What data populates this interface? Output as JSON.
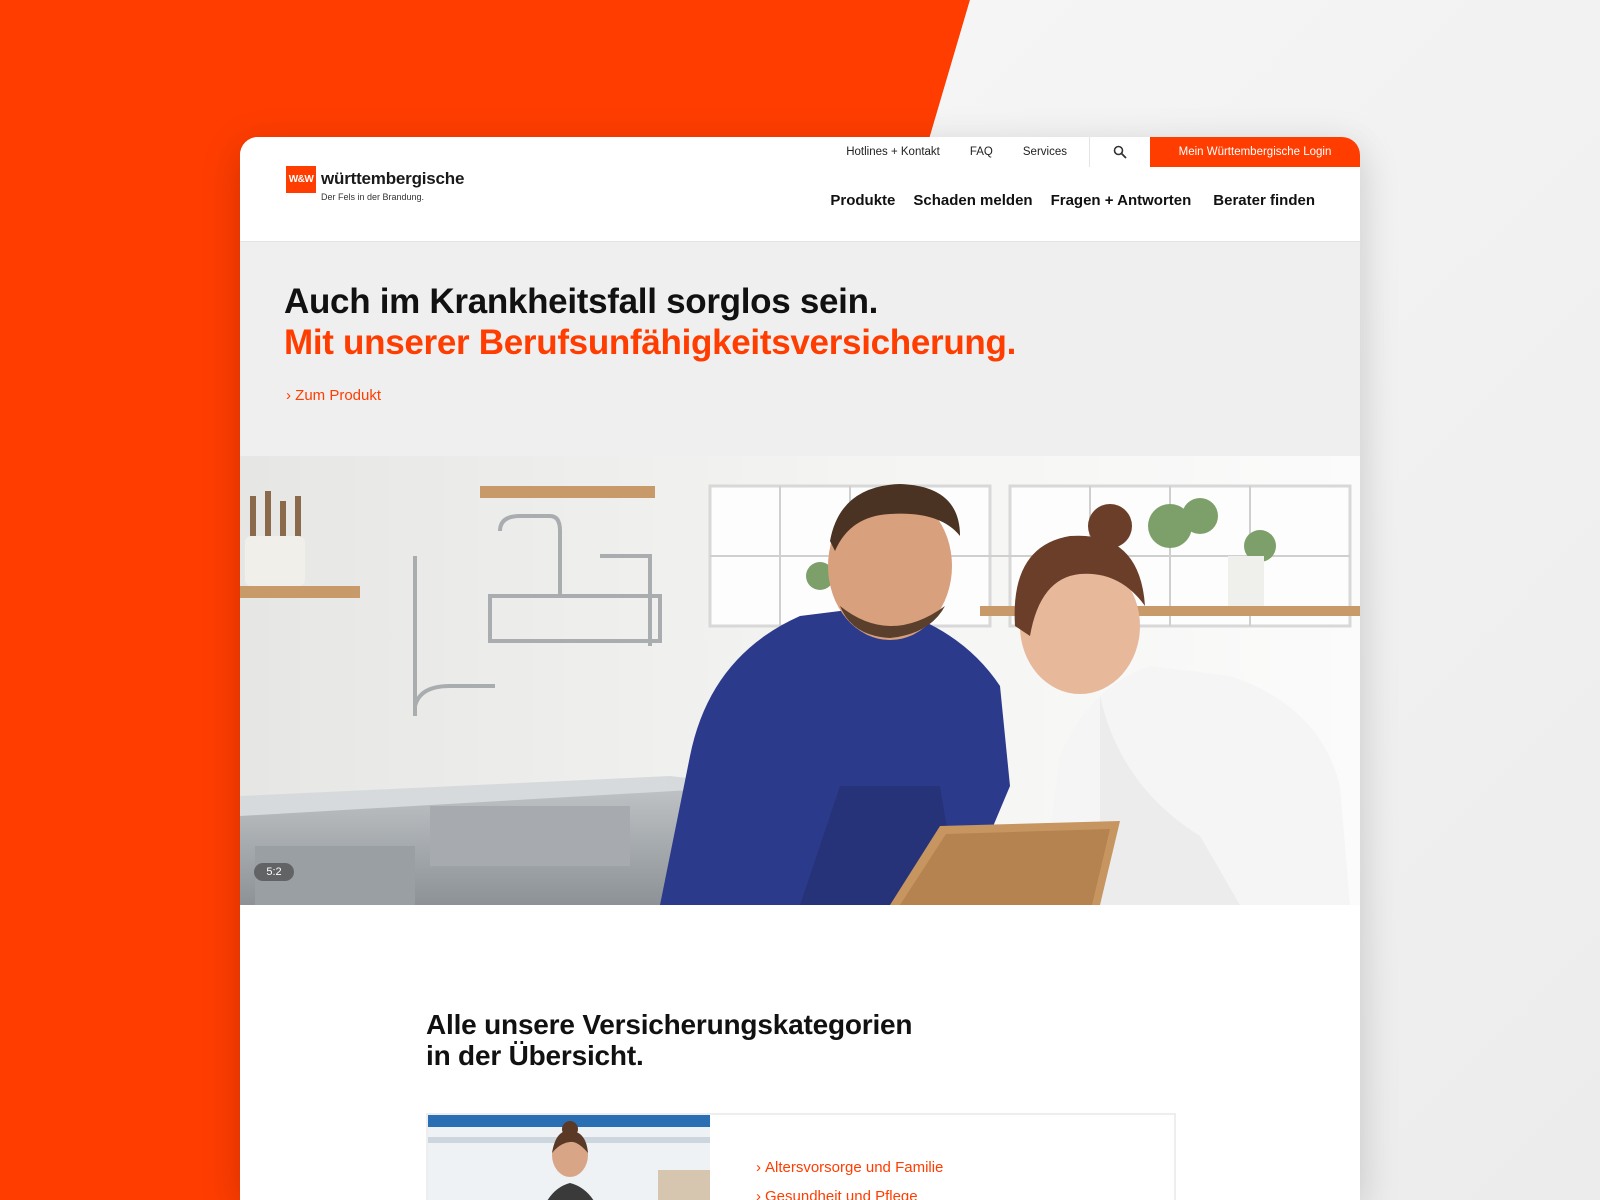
{
  "brand": {
    "logo_mark": "W&W",
    "name": "württembergische",
    "slogan": "Der Fels in der Brandung."
  },
  "top_nav": {
    "items": [
      "Hotlines + Kontakt",
      "FAQ",
      "Services"
    ],
    "login_label": "Mein Württembergische Login"
  },
  "main_nav": {
    "items": [
      "Produkte",
      "Schaden melden",
      "Fragen + Antworten",
      "Berater finden"
    ]
  },
  "hero": {
    "line1": "Auch im Krankheitsfall sorglos sein.",
    "line2": "Mit unserer Berufsunfähigkeitsversicherung.",
    "link_label": "Zum Produkt",
    "ratio_badge": "5:2"
  },
  "categories": {
    "title_line1": "Alle unsere Versicherungskategorien",
    "title_line2": "in der Übersicht.",
    "items": [
      "Altersvorsorge und Familie",
      "Gesundheit und Pflege"
    ]
  },
  "colors": {
    "accent": "#ff3d00",
    "text": "#111111",
    "hero_bg": "#efefef"
  }
}
